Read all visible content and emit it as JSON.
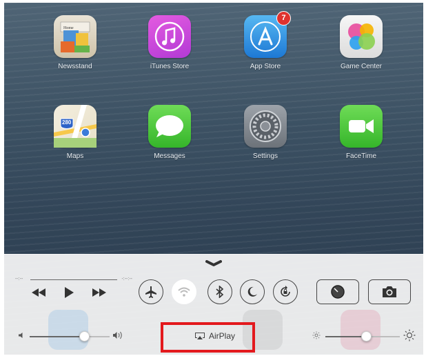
{
  "home_screen": {
    "apps": [
      {
        "label": "Newsstand",
        "icon": "newsstand-icon"
      },
      {
        "label": "iTunes Store",
        "icon": "itunes-store-icon"
      },
      {
        "label": "App Store",
        "icon": "app-store-icon",
        "badge": "7"
      },
      {
        "label": "Game Center",
        "icon": "game-center-icon"
      },
      {
        "label": "Maps",
        "icon": "maps-icon",
        "sign": "280"
      },
      {
        "label": "Messages",
        "icon": "messages-icon"
      },
      {
        "label": "Settings",
        "icon": "settings-icon"
      },
      {
        "label": "FaceTime",
        "icon": "facetime-icon"
      }
    ],
    "newsstand_text": "Home"
  },
  "control_center": {
    "track": {
      "elapsed": "--:--",
      "remaining": "-:--:--"
    },
    "media_buttons": [
      "rewind-icon",
      "play-icon",
      "fast-forward-icon"
    ],
    "toggles": [
      {
        "name": "airplane-mode",
        "icon": "airplane-icon",
        "on": false
      },
      {
        "name": "wifi",
        "icon": "wifi-icon",
        "on": true
      },
      {
        "name": "bluetooth",
        "icon": "bluetooth-icon",
        "on": false
      },
      {
        "name": "do-not-disturb",
        "icon": "moon-icon",
        "on": false
      },
      {
        "name": "rotation-lock",
        "icon": "rotation-lock-icon",
        "on": false
      }
    ],
    "shortcuts": [
      "timer-icon",
      "camera-icon"
    ],
    "volume_level": 0.68,
    "brightness_level": 0.55,
    "airplay_label": "AirPlay"
  },
  "colors": {
    "highlight": "#e3191d",
    "badge": "#e0322e"
  }
}
